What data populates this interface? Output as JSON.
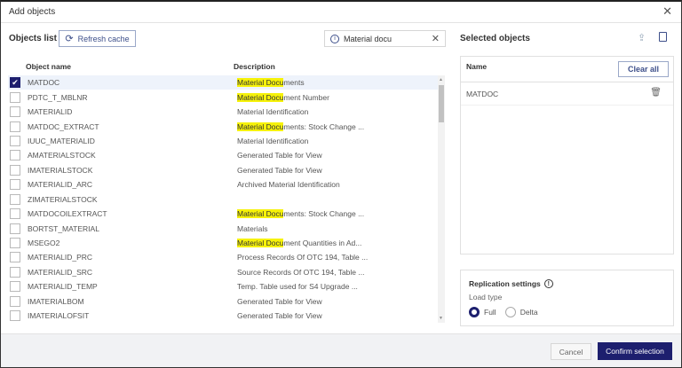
{
  "dialog": {
    "title": "Add objects"
  },
  "objects_list": {
    "heading": "Objects list",
    "refresh_label": "Refresh cache",
    "search_value": "Material docu",
    "columns": [
      "Object name",
      "Description"
    ],
    "rows": [
      {
        "name": "MATDOC",
        "hl": "Material Docu",
        "rest": "ments",
        "checked": true
      },
      {
        "name": "PDTC_T_MBLNR",
        "hl": "Material Docu",
        "rest": "ment Number",
        "checked": false
      },
      {
        "name": "MATERIALID",
        "hl": "",
        "rest": "Material Identification",
        "checked": false
      },
      {
        "name": "MATDOC_EXTRACT",
        "hl": "Material Docu",
        "rest": "ments: Stock Change ...",
        "checked": false
      },
      {
        "name": "IUUC_MATERIALID",
        "hl": "",
        "rest": "Material Identification",
        "checked": false
      },
      {
        "name": "AMATERIALSTOCK",
        "hl": "",
        "rest": "Generated Table for View",
        "checked": false
      },
      {
        "name": "IMATERIALSTOCK",
        "hl": "",
        "rest": "Generated Table for View",
        "checked": false
      },
      {
        "name": "MATERIALID_ARC",
        "hl": "",
        "rest": "Archived Material Identification",
        "checked": false
      },
      {
        "name": "ZIMATERIALSTOCK",
        "hl": "",
        "rest": "",
        "checked": false
      },
      {
        "name": "MATDOCOILEXTRACT",
        "hl": "Material Docu",
        "rest": "ments: Stock Change ...",
        "checked": false
      },
      {
        "name": "BORTST_MATERIAL",
        "hl": "",
        "rest": "Materials",
        "checked": false
      },
      {
        "name": "MSEGO2",
        "hl": "Material Docu",
        "rest": "ment Quantities in Ad...",
        "checked": false
      },
      {
        "name": "MATERIALID_PRC",
        "hl": "",
        "rest": "Process Records Of OTC 194, Table ...",
        "checked": false
      },
      {
        "name": "MATERIALID_SRC",
        "hl": "",
        "rest": "Source Records Of OTC 194, Table ...",
        "checked": false
      },
      {
        "name": "MATERIALID_TEMP",
        "hl": "",
        "rest": "Temp. Table used for S4 Upgrade ...",
        "checked": false
      },
      {
        "name": "IMATERIALBOM",
        "hl": "",
        "rest": "Generated Table for View",
        "checked": false
      },
      {
        "name": "IMATERIALOFSIT",
        "hl": "",
        "rest": "Generated Table for View",
        "checked": false
      }
    ]
  },
  "selected": {
    "heading": "Selected objects",
    "column": "Name",
    "clear_label": "Clear all",
    "items": [
      "MATDOC"
    ]
  },
  "replication": {
    "heading": "Replication settings",
    "load_type_label": "Load type",
    "options": [
      "Full",
      "Delta"
    ],
    "selected": "Full"
  },
  "footer": {
    "cancel_label": "Cancel",
    "confirm_label": "Confirm selection"
  },
  "colors": {
    "accent": "#1d1f6e",
    "highlight": "#f6f20a"
  }
}
